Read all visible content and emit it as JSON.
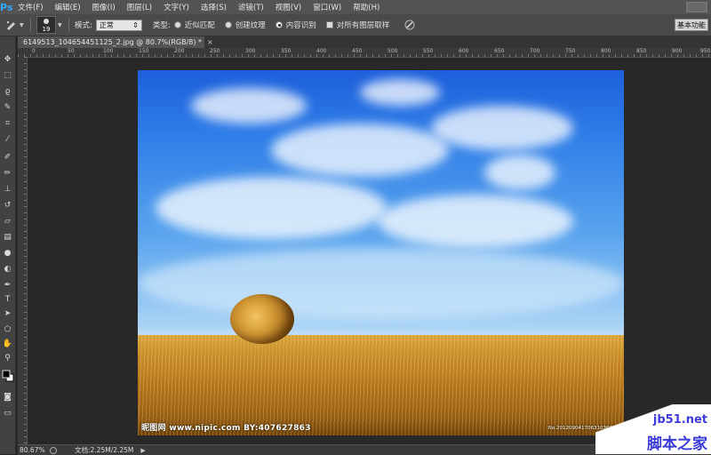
{
  "app": {
    "logo": "Ps"
  },
  "menu": [
    "文件(F)",
    "编辑(E)",
    "图像(I)",
    "图层(L)",
    "文字(Y)",
    "选择(S)",
    "滤镜(T)",
    "视图(V)",
    "窗口(W)",
    "帮助(H)"
  ],
  "options": {
    "brush_size": "19",
    "mode_label": "模式:",
    "mode_value": "正常",
    "type_label": "类型:",
    "radio_1": "近似匹配",
    "radio_2": "创建纹理",
    "radio_3": "内容识别",
    "selected_radio": "内容识别",
    "sample_all_layers": "对所有图层取样",
    "workspace": "基本功能"
  },
  "document": {
    "tab_title": "6149513_104654451125_2.jpg @ 80.7%(RGB/8) *",
    "watermark_left": "昵图网 www.nipic.com  BY:407627863",
    "watermark_right": "No.20120904170631036000"
  },
  "ruler": {
    "h_ticks": [
      "0",
      "50",
      "100",
      "150",
      "200",
      "250",
      "300",
      "350",
      "400",
      "450",
      "500",
      "550",
      "600",
      "650",
      "700",
      "750",
      "800",
      "850",
      "900",
      "950"
    ]
  },
  "status": {
    "zoom": "80.67%",
    "doc_size": "文档:2.25M/2.25M"
  },
  "site": {
    "url": "jb51.net",
    "name": "脚本之家"
  },
  "colors": {
    "accent": "#31a8ff",
    "panel": "#535353",
    "background": "#282828"
  }
}
